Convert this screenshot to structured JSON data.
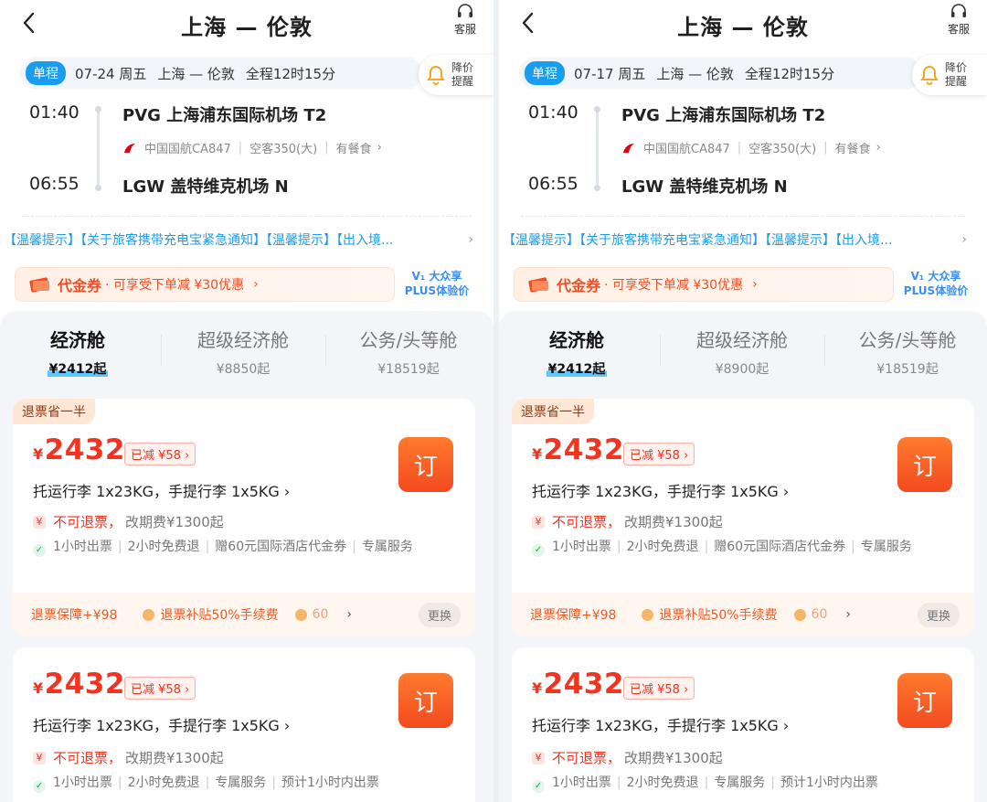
{
  "panels": [
    {
      "title": "上海 — 伦敦",
      "service_label": "客服",
      "summary": {
        "trip_type": "单程",
        "date": "07-24 周五",
        "route": "上海 — 伦敦",
        "duration": "全程12时15分"
      },
      "price_alert": {
        "line1": "降价",
        "line2": "提醒"
      },
      "flight": {
        "dep_time": "01:40",
        "dep_airport": "PVG 上海浦东国际机场 T2",
        "airline": "中国国航CA847",
        "aircraft": "空客350(大)",
        "meal": "有餐食",
        "arr_time": "06:55",
        "arr_airport": "LGW 盖特维克机场 N"
      },
      "notice": "【温馨提示】【关于旅客携带充电宝紧急通知】【温馨提示】【出入境...",
      "coupon": {
        "title": "代金券",
        "desc": "· 可享受下单减 ¥30优惠",
        "chev": "›"
      },
      "plus": {
        "line1": "V₁ 大众享",
        "line2": "PLUS体验价"
      },
      "cabins": [
        {
          "name": "经济舱",
          "price": "¥2412起"
        },
        {
          "name": "超级经济舱",
          "price": "¥8850起"
        },
        {
          "name": "公务/头等舱",
          "price": "¥18519起"
        }
      ],
      "cards": [
        {
          "tag": "退票省一半",
          "currency": "¥",
          "price": "2432",
          "discount": "已减 ¥58 ›",
          "order": "订",
          "baggage": "托运行李 1x23KG，手提行李 1x5KG ›",
          "refund": "不可退票，",
          "change": "改期费¥1300起",
          "features": [
            "1小时出票",
            "2小时免费退",
            "赠60元国际酒店代金券",
            "专属服务"
          ],
          "guard": {
            "label": "退票保障+¥98",
            "benefit": "退票补贴50%手续费",
            "more": "60",
            "swap": "更换"
          }
        },
        {
          "currency": "¥",
          "price": "2432",
          "discount": "已减 ¥58 ›",
          "order": "订",
          "baggage": "托运行李 1x23KG，手提行李 1x5KG ›",
          "refund": "不可退票，",
          "change": "改期费¥1300起",
          "features": [
            "1小时出票",
            "2小时免费退",
            "专属服务",
            "预计1小时内出票"
          ]
        }
      ]
    },
    {
      "title": "上海 — 伦敦",
      "service_label": "客服",
      "summary": {
        "trip_type": "单程",
        "date": "07-17 周五",
        "route": "上海 — 伦敦",
        "duration": "全程12时15分"
      },
      "price_alert": {
        "line1": "降价",
        "line2": "提醒"
      },
      "flight": {
        "dep_time": "01:40",
        "dep_airport": "PVG 上海浦东国际机场 T2",
        "airline": "中国国航CA847",
        "aircraft": "空客350(大)",
        "meal": "有餐食",
        "arr_time": "06:55",
        "arr_airport": "LGW 盖特维克机场 N"
      },
      "notice": "【温馨提示】【关于旅客携带充电宝紧急通知】【温馨提示】【出入境...",
      "coupon": {
        "title": "代金券",
        "desc": "· 可享受下单减 ¥30优惠",
        "chev": "›"
      },
      "plus": {
        "line1": "V₁ 大众享",
        "line2": "PLUS体验价"
      },
      "cabins": [
        {
          "name": "经济舱",
          "price": "¥2412起"
        },
        {
          "name": "超级经济舱",
          "price": "¥8900起"
        },
        {
          "name": "公务/头等舱",
          "price": "¥18519起"
        }
      ],
      "cards": [
        {
          "tag": "退票省一半",
          "currency": "¥",
          "price": "2432",
          "discount": "已减 ¥58 ›",
          "order": "订",
          "baggage": "托运行李 1x23KG，手提行李 1x5KG ›",
          "refund": "不可退票，",
          "change": "改期费¥1300起",
          "features": [
            "1小时出票",
            "2小时免费退",
            "赠60元国际酒店代金券",
            "专属服务"
          ],
          "guard": {
            "label": "退票保障+¥98",
            "benefit": "退票补贴50%手续费",
            "more": "60",
            "swap": "更换"
          }
        },
        {
          "currency": "¥",
          "price": "2432",
          "discount": "已减 ¥58 ›",
          "order": "订",
          "baggage": "托运行李 1x23KG，手提行李 1x5KG ›",
          "refund": "不可退票，",
          "change": "改期费¥1300起",
          "features": [
            "1小时出票",
            "2小时免费退",
            "专属服务",
            "预计1小时内出票"
          ]
        }
      ]
    }
  ],
  "colors": {
    "accent": "#1a9df0",
    "price": "#f2331f",
    "order_button": "#f24a1f"
  }
}
